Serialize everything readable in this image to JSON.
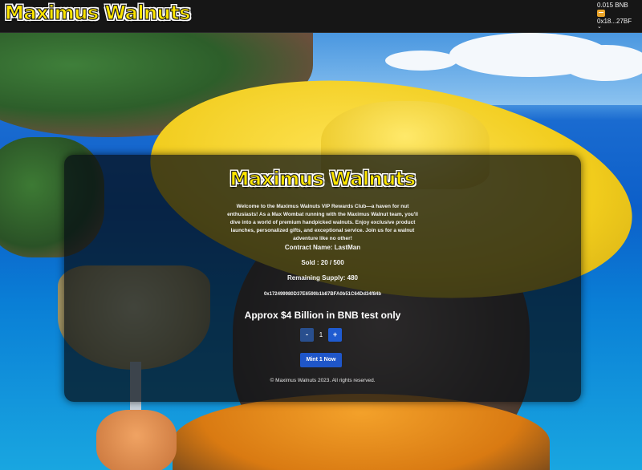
{
  "header": {
    "logo_text": "Maximus Walnuts",
    "wallet": {
      "balance": "0.015 BNB",
      "icon": "wallet-icon",
      "address": "0x18...27BF",
      "chevron": "⌄"
    }
  },
  "card": {
    "logo_text": "Maximus Walnuts",
    "welcome": "Welcome to the Maximus Walnuts VIP Rewards Club—a haven for nut enthusiasts! As a Max Wombat running with the Maximus Walnut team, you'll dive into a world of premium handpicked walnuts. Enjoy exclusive product launches, personalized gifts, and exceptional service. Join us for a walnut adventure like no other!",
    "contract_name": "Contract Name: LastMan",
    "sold": "Sold : 20 / 500",
    "remaining": "Remaining Supply: 480",
    "contract_address": "0x172499980D37E6590b1b87BFA0b51C64Dd34f84b",
    "approx": "Approx $4 Billion in BNB test only",
    "quantity": {
      "minus_label": "-",
      "value": "1",
      "plus_label": "+"
    },
    "mint_label": "Mint 1 Now",
    "footer": "© Maximus Walnuts 2023. All rights reserved."
  },
  "colors": {
    "accent": "#1f56c9",
    "logo_yellow": "#ffe600",
    "topbar": "#161616"
  }
}
